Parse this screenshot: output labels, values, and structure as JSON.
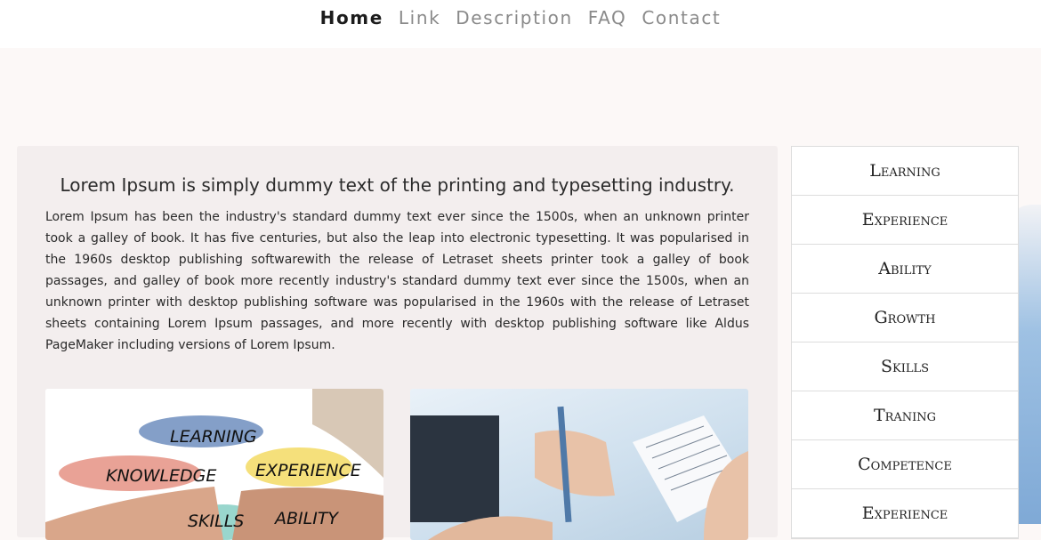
{
  "nav": {
    "items": [
      "Home",
      "Link",
      "Description",
      "FAQ",
      "Contact"
    ],
    "active": "Home"
  },
  "main": {
    "title": "Lorem Ipsum is simply dummy text of the printing and typesetting industry.",
    "body": "Lorem Ipsum has been the industry's standard dummy text ever since the 1500s, when an unknown printer took a galley of book. It has five centuries, but also the leap into electronic typesetting. It was popularised in the 1960s desktop publishing softwarewith the release of Letraset sheets printer took a galley of book passages, and galley of book more recently industry's standard dummy text ever since the 1500s, when an unknown printer with desktop publishing software was popularised in the 1960s with the release of Letraset sheets containing Lorem Ipsum passages, and more recently with desktop publishing software like Aldus PageMaker including versions of Lorem Ipsum.",
    "image_left_words": [
      "LEARNING",
      "KNOWLEDGE",
      "EXPERIENCE",
      "SKILLS",
      "ABILITY"
    ]
  },
  "sidebar": {
    "items": [
      "Learning",
      "Experience",
      "Ability",
      "Growth",
      "Skills",
      "Traning",
      "Competence",
      "Experience"
    ]
  },
  "colors": {
    "background": "#fcf8f7",
    "card": "#f3eeee",
    "nav_active": "#1c1c1c",
    "nav_inactive": "#8a8a8a"
  }
}
